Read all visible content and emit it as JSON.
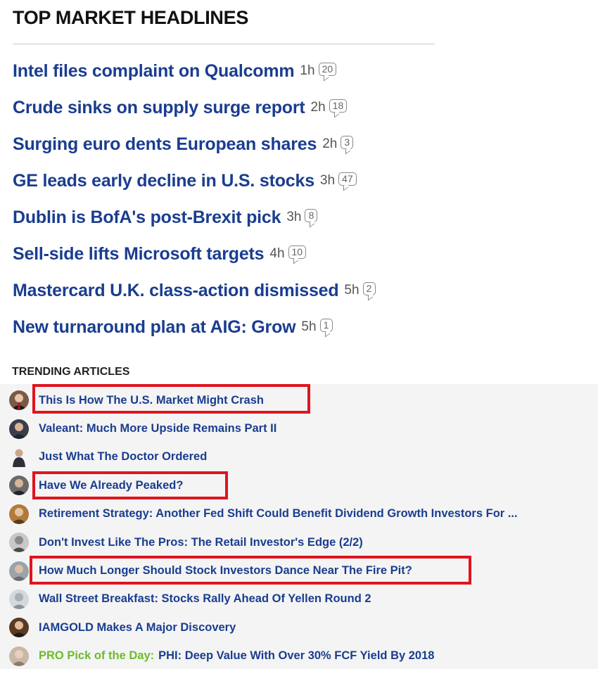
{
  "top": {
    "title": "TOP MARKET HEADLINES",
    "headlines": [
      {
        "title": "Intel files complaint on Qualcomm",
        "age": "1h",
        "comments": "20"
      },
      {
        "title": "Crude sinks on supply surge report",
        "age": "2h",
        "comments": "18"
      },
      {
        "title": "Surging euro dents European shares",
        "age": "2h",
        "comments": "3"
      },
      {
        "title": "GE leads early decline in U.S. stocks",
        "age": "3h",
        "comments": "47"
      },
      {
        "title": "Dublin is BofA's post-Brexit pick",
        "age": "3h",
        "comments": "8"
      },
      {
        "title": "Sell-side lifts Microsoft targets",
        "age": "4h",
        "comments": "10"
      },
      {
        "title": "Mastercard U.K. class-action dismissed",
        "age": "5h",
        "comments": "2"
      },
      {
        "title": "New turnaround plan at AIG: Grow",
        "age": "5h",
        "comments": "1"
      }
    ]
  },
  "trending": {
    "title": "TRENDING ARTICLES",
    "articles": [
      {
        "title": "This Is How The U.S. Market Might Crash",
        "highlighted": true
      },
      {
        "title": "Valeant: Much More Upside Remains Part II",
        "highlighted": false
      },
      {
        "title": "Just What The Doctor Ordered",
        "highlighted": false
      },
      {
        "title": "Have We Already Peaked?",
        "highlighted": true
      },
      {
        "title": "Retirement Strategy: Another Fed Shift Could Benefit Dividend Growth Investors For ...",
        "highlighted": false
      },
      {
        "title": "Don't Invest Like The Pros: The Retail Investor's Edge (2/2)",
        "highlighted": false
      },
      {
        "title": "How Much Longer Should Stock Investors Dance Near The Fire Pit?",
        "highlighted": true
      },
      {
        "title": "Wall Street Breakfast: Stocks Rally Ahead Of Yellen Round 2",
        "highlighted": false
      },
      {
        "title": "IAMGOLD Makes A Major Discovery",
        "highlighted": false
      },
      {
        "title": "PHI: Deep Value With Over 30% FCF Yield By 2018",
        "highlighted": false,
        "prefix": "PRO Pick of the Day:"
      }
    ]
  },
  "colors": {
    "link": "#1a3d8f",
    "pro": "#6dbb2a",
    "highlight": "#e0141e"
  }
}
